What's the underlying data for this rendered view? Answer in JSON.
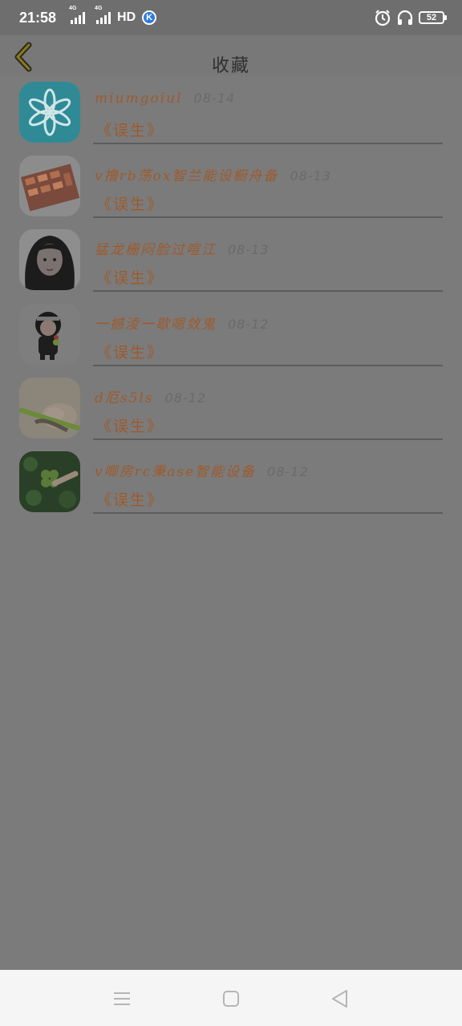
{
  "status": {
    "time": "21:58",
    "signal1_tag": "4G",
    "signal2_tag": "4G",
    "network": "HD",
    "app_badge": "K",
    "battery": "52"
  },
  "header": {
    "title": "收藏",
    "back_icon": "chevron-left-icon"
  },
  "favorites": [
    {
      "name": "miumgoiul",
      "date": "08-14",
      "book": "《误生》",
      "avatar": "snowflake"
    },
    {
      "name": "v撸rb荡ox智兰能设橱舟备",
      "date": "08-13",
      "book": "《误生》",
      "avatar": "skewers"
    },
    {
      "name": "猛龙栅闷脸过喧江",
      "date": "08-13",
      "book": "《误生》",
      "avatar": "girl"
    },
    {
      "name": "一撼淩一歇嗯敛鬼",
      "date": "08-12",
      "book": "《误生》",
      "avatar": "ninja"
    },
    {
      "name": "d厄s5ls",
      "date": "08-12",
      "book": "《误生》",
      "avatar": "sleeping"
    },
    {
      "name": "v唧房rc秉ase智能设备",
      "date": "08-12",
      "book": "《误生》",
      "avatar": "clover"
    }
  ],
  "navbar": {
    "menu_icon": "menu-icon",
    "home_icon": "home-square-icon",
    "back_icon": "back-triangle-icon"
  },
  "colors": {
    "overlay": "#7b7b7b",
    "name_text": "#9e5a2c",
    "date_text": "#6a6a6a",
    "navbar_bg": "#f5f5f5"
  }
}
